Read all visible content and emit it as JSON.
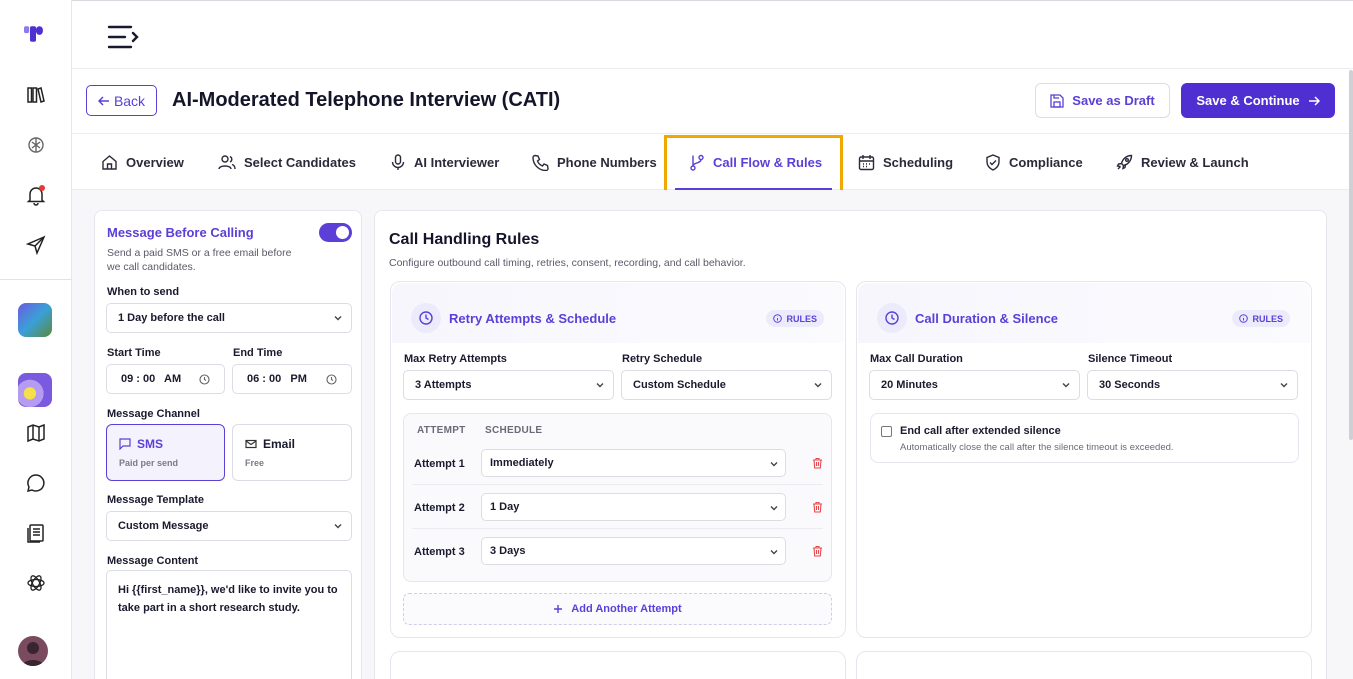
{
  "header": {
    "back_label": "Back",
    "title": "AI-Moderated Telephone Interview (CATI)",
    "save_draft_label": "Save as Draft",
    "save_continue_label": "Save & Continue"
  },
  "tabs": [
    {
      "label": "Overview",
      "icon": "home-icon"
    },
    {
      "label": "Select Candidates",
      "icon": "users-icon"
    },
    {
      "label": "AI Interviewer",
      "icon": "microphone-icon"
    },
    {
      "label": "Phone Numbers",
      "icon": "phone-icon"
    },
    {
      "label": "Call Flow & Rules",
      "icon": "git-branch-icon",
      "active": true
    },
    {
      "label": "Scheduling",
      "icon": "calendar-icon"
    },
    {
      "label": "Compliance",
      "icon": "shield-check-icon"
    },
    {
      "label": "Review & Launch",
      "icon": "rocket-icon"
    }
  ],
  "message": {
    "title": "Message Before Calling",
    "desc_line1": "Send a paid SMS or a free email before",
    "desc_line2": "we call candidates.",
    "enabled": true,
    "when_label": "When to send",
    "when_value": "1 Day before the call",
    "start_label": "Start Time",
    "start_value": "09 : 00   AM",
    "end_label": "End Time",
    "end_value": "06 : 00   PM",
    "channel_label": "Message Channel",
    "channels": [
      {
        "name": "SMS",
        "sub": "Paid per send",
        "selected": true
      },
      {
        "name": "Email",
        "sub": "Free",
        "selected": false
      }
    ],
    "template_label": "Message Template",
    "template_value": "Custom Message",
    "content_label": "Message Content",
    "content_value": "Hi {{first_name}}, we'd like to invite you to take part in a short research study."
  },
  "rules": {
    "title": "Call Handling Rules",
    "desc": "Configure outbound call timing, retries, consent, recording, and call behavior.",
    "badge": "RULES",
    "retry": {
      "title": "Retry Attempts & Schedule",
      "max_label": "Max Retry Attempts",
      "max_value": "3 Attempts",
      "schedule_label": "Retry Schedule",
      "schedule_value": "Custom Schedule",
      "col_attempt": "ATTEMPT",
      "col_schedule": "SCHEDULE",
      "attempts": [
        {
          "label": "Attempt 1",
          "value": "Immediately"
        },
        {
          "label": "Attempt 2",
          "value": "1 Day"
        },
        {
          "label": "Attempt 3",
          "value": "3 Days"
        }
      ],
      "add_label": "Add Another Attempt"
    },
    "duration": {
      "title": "Call Duration & Silence",
      "max_label": "Max Call Duration",
      "max_value": "20 Minutes",
      "silence_label": "Silence Timeout",
      "silence_value": "30 Seconds",
      "end_call_label": "End call after extended silence",
      "end_call_desc": "Automatically close the call after the silence timeout is exceeded.",
      "end_call_checked": false
    }
  },
  "colors": {
    "accent": "#5b3fd6",
    "primary_button": "#4f2fd1",
    "highlight": "#f0a800",
    "notification": "#e53935"
  }
}
